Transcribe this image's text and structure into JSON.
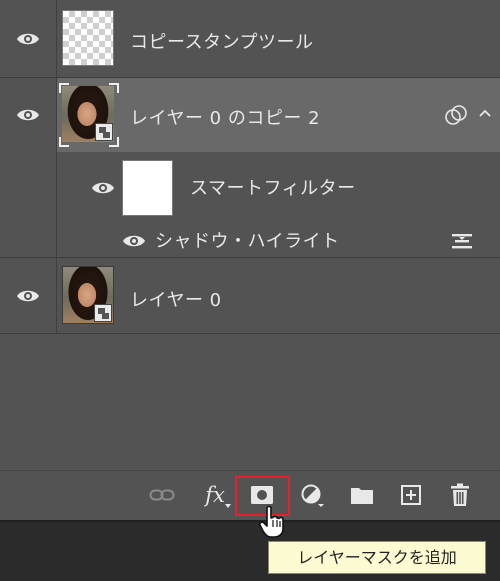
{
  "layers": {
    "stamp": {
      "name": "コピースタンプツール"
    },
    "copy": {
      "name": "レイヤー 0 のコピー 2"
    },
    "smart_filter": {
      "name": "スマートフィルター"
    },
    "shadow_filter": {
      "name": "シャドウ・ハイライト"
    },
    "layer0": {
      "name": "レイヤー 0"
    }
  },
  "toolbar": {
    "fx_label": "fx",
    "tooltip": "レイヤーマスクを追加"
  },
  "icons": [
    "eye-icon",
    "link-icon",
    "fx-icon",
    "mask-icon",
    "adjustment-icon",
    "folder-icon",
    "new-layer-icon",
    "trash-icon",
    "filter-options-icon",
    "smart-object-icon",
    "expand-chevron-icon",
    "cursor-hand-icon"
  ],
  "colors": {
    "panel": "#535353",
    "selected": "#696969",
    "highlight": "#e8202a",
    "tooltip_bg": "#fdfbd2"
  }
}
